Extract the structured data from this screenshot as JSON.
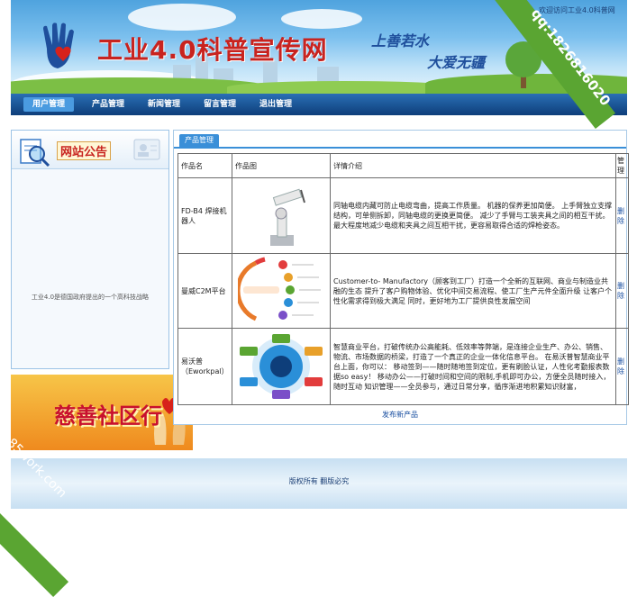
{
  "header": {
    "welcome": "您好，欢迎访问工业4.0科普网",
    "site_title": "工业4.0科普宣传网",
    "slogan_1": "上善若水",
    "slogan_2": "大爱无疆"
  },
  "nav": {
    "items": [
      {
        "label": "用户管理",
        "active": true
      },
      {
        "label": "产品管理"
      },
      {
        "label": "新闻管理"
      },
      {
        "label": "留言管理"
      },
      {
        "label": "退出管理"
      }
    ]
  },
  "notice": {
    "title": "网站公告",
    "text": "工业4.0是德国政府提出的一个高科技战略"
  },
  "charity": {
    "text": "慈善社区行"
  },
  "product_panel": {
    "tab": "产品管理",
    "columns": [
      "作品名",
      "作品图",
      "详情介绍",
      "管理"
    ],
    "rows": [
      {
        "name": "FD-B4 焊接机器人",
        "image": "welding-robot-image",
        "detail": "同轴电缆内藏可防止电缆弯曲，提高工作质量。 机器的保养更加简便。 上手臂独立支撑结构，可单侧拆卸，同轴电缆的更换更简便。 减少了手臂与工装夹具之间的相互干扰。 最大程度地减少电缆和夹具之间互相干扰，更容易取得合适的焊枪姿态。",
        "action": "删除"
      },
      {
        "name": "曼威C2M平台",
        "image": "c2m-platform-diagram",
        "detail": "Customer-to- Manufactory（顾客到工厂）打造一个全新的互联网、商业与制造业共融的生态 提升了客户购物体验、优化中间交易流程、使工厂生产元件全面升级 让客户个性化需求得到极大满足 同时，更好地为工厂提供良性发展空间",
        "action": "删除"
      },
      {
        "name": "易沃普（Eworkpal）",
        "image": "eworkpal-diagram",
        "detail": "智慧商业平台，打破传统办公高能耗、低效率等弊端，是连接企业生产、办公、销售、物流、市场数据的桥梁，打造了一个真正的企业一体化信息平台。 在易沃普智慧商业平台上面，你可以： 移动签到——随时随地签到定位，更有刷脸认证，人性化考勤报表数据so easy！ 移动办公——打破时间和空间的限制,手机即可办公，方便全员随时接入，随时互动 知识管理——全员参与，通过日常分享，循序渐进地积累知识财富，",
        "action": "删除"
      }
    ],
    "publish": "发布新产品"
  },
  "footer": {
    "copyright": "版权所有 翻版必究"
  },
  "watermarks": {
    "qq": "qq:1826816020",
    "site": "85work.com"
  },
  "colors": {
    "nav_bg": "#0e3e7a",
    "accent": "#3a8fd8",
    "title_red": "#c8231f",
    "watermark_green": "#5aa532"
  }
}
